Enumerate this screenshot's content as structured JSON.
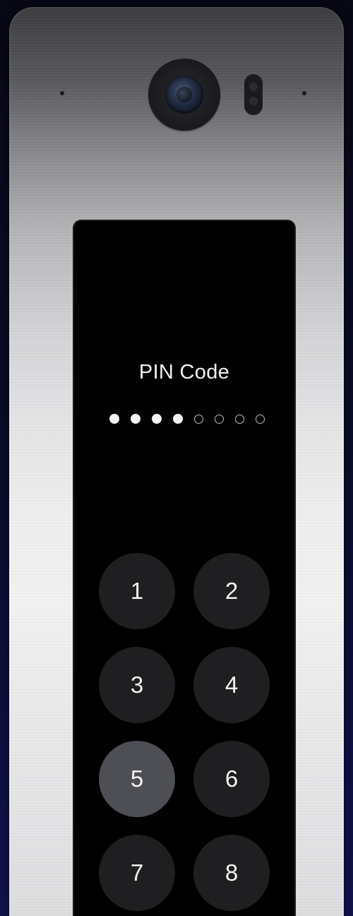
{
  "screen": {
    "title": "PIN Code",
    "pin_length": 8,
    "pin_entered": 4
  },
  "keypad": {
    "keys": [
      "1",
      "2",
      "3",
      "4",
      "5",
      "6",
      "7",
      "8"
    ],
    "highlighted_key": "5"
  },
  "colors": {
    "screen_background": "#000000",
    "key_background": "#1f1f21",
    "key_highlight": "#4d4f55",
    "text": "#f2f2f2"
  },
  "icons": {
    "camera": "camera-icon"
  }
}
